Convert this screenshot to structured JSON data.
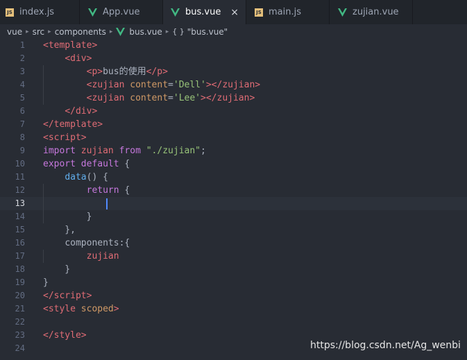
{
  "tabs": [
    {
      "label": "index.js",
      "icon": "js-icon",
      "active": false
    },
    {
      "label": "App.vue",
      "icon": "vue-icon",
      "active": false
    },
    {
      "label": "bus.vue",
      "icon": "vue-icon",
      "active": true,
      "close": "×"
    },
    {
      "label": "main.js",
      "icon": "js-icon",
      "active": false
    },
    {
      "label": "zujian.vue",
      "icon": "vue-icon",
      "active": false
    }
  ],
  "breadcrumb": [
    "vue",
    "src",
    "components",
    "bus.vue",
    "\"bus.vue\""
  ],
  "js_badge": "JS",
  "brace_glyph": "{ }",
  "editor": {
    "current_line": 13,
    "lines": [
      {
        "n": "1",
        "tokens": [
          [
            "tag",
            "<template"
          ],
          [
            "tag",
            ">"
          ]
        ]
      },
      {
        "n": "2",
        "tokens": [
          [
            "plain",
            "    "
          ],
          [
            "tag",
            "<div"
          ],
          [
            "tag",
            ">"
          ]
        ]
      },
      {
        "n": "3",
        "tokens": [
          [
            "plain",
            "        "
          ],
          [
            "tag",
            "<"
          ],
          [
            "tag",
            "p"
          ],
          [
            "tag",
            ">"
          ],
          [
            "plain",
            "bus的使用"
          ],
          [
            "tag",
            "</"
          ],
          [
            "tag",
            "p"
          ],
          [
            "tag",
            ">"
          ]
        ]
      },
      {
        "n": "4",
        "tokens": [
          [
            "plain",
            "        "
          ],
          [
            "tag",
            "<zujian"
          ],
          [
            "plain",
            " "
          ],
          [
            "attr",
            "content"
          ],
          [
            "punc",
            "="
          ],
          [
            "str",
            "'Dell'"
          ],
          [
            "tag",
            "></"
          ],
          [
            "tag",
            "zujian"
          ],
          [
            "tag",
            ">"
          ]
        ]
      },
      {
        "n": "5",
        "tokens": [
          [
            "plain",
            "        "
          ],
          [
            "tag",
            "<zujian"
          ],
          [
            "plain",
            " "
          ],
          [
            "attr",
            "content"
          ],
          [
            "punc",
            "="
          ],
          [
            "str",
            "'Lee'"
          ],
          [
            "tag",
            "></"
          ],
          [
            "tag",
            "zujian"
          ],
          [
            "tag",
            ">"
          ]
        ]
      },
      {
        "n": "6",
        "tokens": [
          [
            "plain",
            "    "
          ],
          [
            "tag",
            "</div"
          ],
          [
            "tag",
            ">"
          ]
        ]
      },
      {
        "n": "7",
        "tokens": [
          [
            "tag",
            "</template"
          ],
          [
            "tag",
            ">"
          ]
        ]
      },
      {
        "n": "8",
        "tokens": [
          [
            "tag",
            "<script"
          ],
          [
            "tag",
            ">"
          ]
        ]
      },
      {
        "n": "9",
        "tokens": [
          [
            "kw",
            "import"
          ],
          [
            "plain",
            " "
          ],
          [
            "var",
            "zujian"
          ],
          [
            "plain",
            " "
          ],
          [
            "kw",
            "from"
          ],
          [
            "plain",
            " "
          ],
          [
            "str",
            "\"./zujian\""
          ],
          [
            "plain",
            ";"
          ]
        ]
      },
      {
        "n": "10",
        "tokens": [
          [
            "kw",
            "export"
          ],
          [
            "plain",
            " "
          ],
          [
            "kw",
            "default"
          ],
          [
            "plain",
            " {"
          ]
        ]
      },
      {
        "n": "11",
        "tokens": [
          [
            "plain",
            "    "
          ],
          [
            "fn",
            "data"
          ],
          [
            "plain",
            "() {"
          ]
        ]
      },
      {
        "n": "12",
        "tokens": [
          [
            "plain",
            "        "
          ],
          [
            "kw",
            "return"
          ],
          [
            "plain",
            " {"
          ]
        ]
      },
      {
        "n": "13",
        "tokens": []
      },
      {
        "n": "14",
        "tokens": [
          [
            "plain",
            "        }"
          ]
        ]
      },
      {
        "n": "15",
        "tokens": [
          [
            "plain",
            "    },"
          ]
        ]
      },
      {
        "n": "16",
        "tokens": [
          [
            "plain",
            "    "
          ],
          [
            "plain",
            "components"
          ],
          [
            "plain",
            ":{"
          ]
        ]
      },
      {
        "n": "17",
        "tokens": [
          [
            "plain",
            "        "
          ],
          [
            "var",
            "zujian"
          ]
        ]
      },
      {
        "n": "18",
        "tokens": [
          [
            "plain",
            "    }"
          ]
        ]
      },
      {
        "n": "19",
        "tokens": [
          [
            "plain",
            "}"
          ]
        ]
      },
      {
        "n": "20",
        "tokens": [
          [
            "tag",
            "</script"
          ],
          [
            "tag",
            ">"
          ]
        ]
      },
      {
        "n": "21",
        "tokens": [
          [
            "tag",
            "<style"
          ],
          [
            "plain",
            " "
          ],
          [
            "attr",
            "scoped"
          ],
          [
            "tag",
            ">"
          ]
        ]
      },
      {
        "n": "22",
        "tokens": []
      },
      {
        "n": "23",
        "tokens": [
          [
            "tag",
            "</style"
          ],
          [
            "tag",
            ">"
          ]
        ]
      },
      {
        "n": "24",
        "tokens": []
      }
    ]
  },
  "colors": {
    "background": "#282c34",
    "tab_bar": "#21252b",
    "tag": "#e06c75",
    "string": "#98c379",
    "keyword": "#c678dd",
    "function": "#61afef",
    "attribute": "#d19a66",
    "vue_green": "#41b883",
    "cursor": "#528bff"
  },
  "watermark": "https://blog.csdn.net/Ag_wenbi"
}
